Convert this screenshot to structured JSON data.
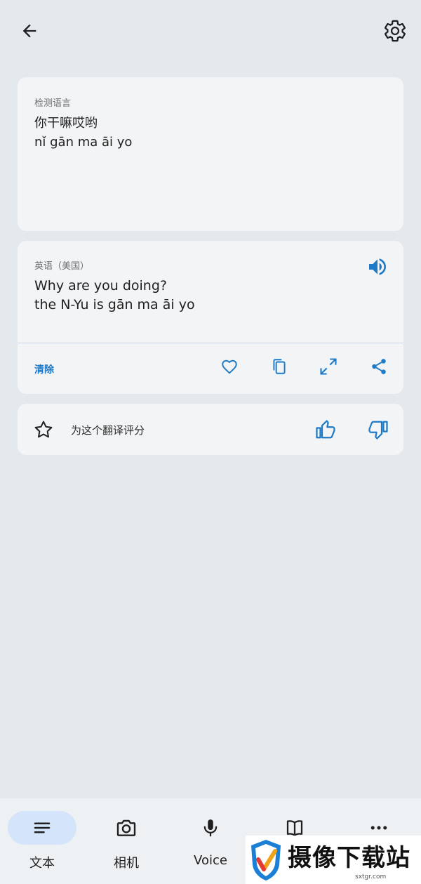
{
  "source": {
    "language": "检测语言",
    "text": "你干嘛哎哟",
    "romanization": "nǐ gān ma āi yo"
  },
  "translation": {
    "language": "英语（美国）",
    "text": "Why are you doing?",
    "romanization": "the N-Yu is gān ma āi yo",
    "clear_label": "清除"
  },
  "rating": {
    "label": "为这个翻译评分"
  },
  "bottom_nav": {
    "items": [
      {
        "label": "文本",
        "icon": "text-lines-icon",
        "active": true
      },
      {
        "label": "相机",
        "icon": "camera-icon",
        "active": false
      },
      {
        "label": "Voice",
        "icon": "microphone-icon",
        "active": false
      },
      {
        "label": "",
        "icon": "book-icon",
        "active": false
      },
      {
        "label": "",
        "icon": "more-icon",
        "active": false
      }
    ]
  },
  "watermark": {
    "text": "摄像下载站",
    "url": "sxtgr.com"
  },
  "colors": {
    "accent": "#1f7ac6",
    "background": "#e4e9ee",
    "card": "#f3f4f6",
    "nav_active": "#d4e4fa"
  }
}
